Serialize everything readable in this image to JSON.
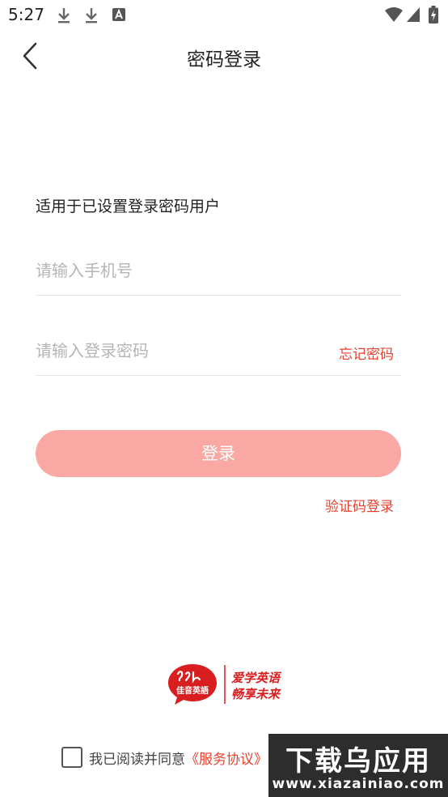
{
  "status_bar": {
    "time": "5:27",
    "left_icons": [
      "download-icon",
      "download-icon",
      "font-icon"
    ],
    "right_icons": [
      "wifi-icon",
      "cell-signal-icon",
      "battery-icon"
    ]
  },
  "header": {
    "back_icon": "chevron-left-icon",
    "title": "密码登录"
  },
  "form": {
    "hint": "适用于已设置登录密码用户",
    "phone_placeholder": "请输入手机号",
    "phone_value": "",
    "password_placeholder": "请输入登录密码",
    "password_value": "",
    "forgot_label": "忘记密码",
    "login_button": "登录",
    "code_login_link": "验证码登录"
  },
  "logo": {
    "icon": "jiayin-logo-icon",
    "brand_text": "佳音英語",
    "slogan_line1": "爱学英语",
    "slogan_line2": "畅享未来"
  },
  "agreement": {
    "checked": false,
    "text": "我已阅读并同意",
    "link": "《服务协议》"
  },
  "watermark": {
    "title": "下载乌应用",
    "url": "www.xiazainiao.com"
  },
  "colors": {
    "accent": "#e8412f",
    "button_disabled": "#f9a8a4",
    "divider": "#e6e6e6",
    "placeholder": "#b5b5b5"
  }
}
